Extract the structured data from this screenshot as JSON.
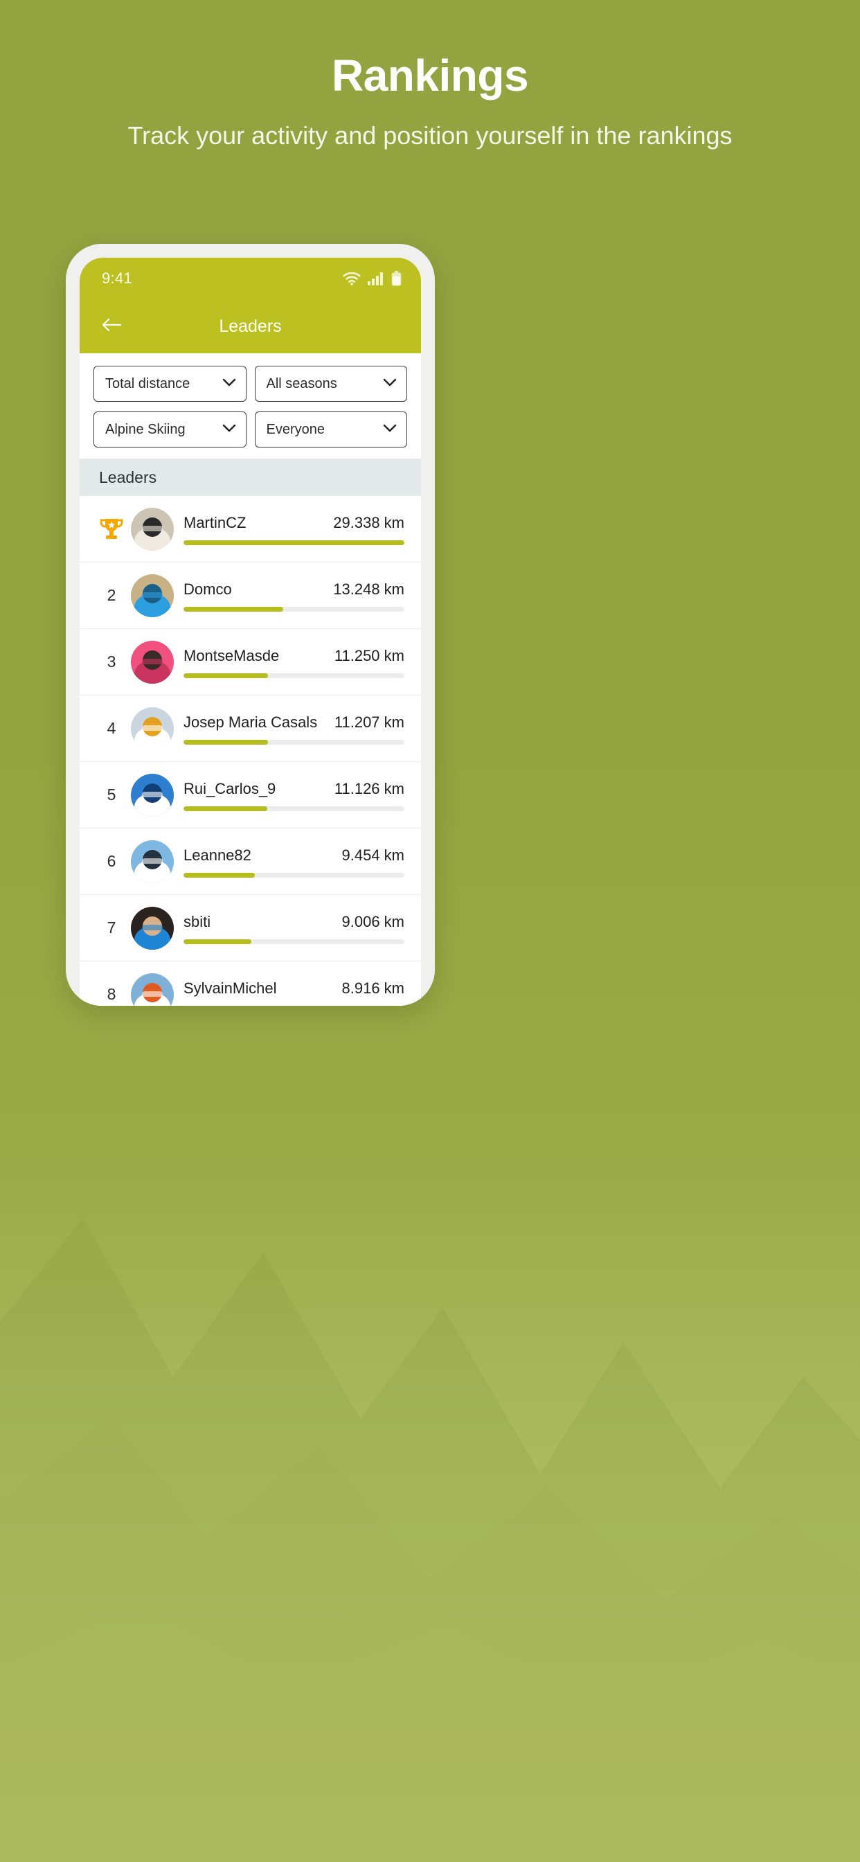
{
  "promo": {
    "title": "Rankings",
    "subtitle": "Track your activity and position yourself in the rankings"
  },
  "colors": {
    "background": "#93a33f",
    "header": "#bcc020",
    "accent": "#b5bd1f",
    "track": "#ececec",
    "section_bg": "#e4e9e9",
    "trophy": "#f5a800"
  },
  "statusbar": {
    "time": "9:41",
    "icons": [
      "wifi-icon",
      "cellular-signal-icon",
      "battery-icon"
    ]
  },
  "appbar": {
    "back_icon": "arrow-left-icon",
    "title": "Leaders"
  },
  "filters": [
    {
      "name": "metric",
      "value": "Total distance",
      "icon": "chevron-down-icon"
    },
    {
      "name": "season",
      "value": "All seasons",
      "icon": "chevron-down-icon"
    },
    {
      "name": "sport",
      "value": "Alpine Skiing",
      "icon": "chevron-down-icon"
    },
    {
      "name": "audience",
      "value": "Everyone",
      "icon": "chevron-down-icon"
    }
  ],
  "section": {
    "title": "Leaders"
  },
  "chart_data": {
    "type": "bar",
    "title": "Leaders",
    "xlabel": "",
    "ylabel": "Total distance (km)",
    "categories": [
      "MartinCZ",
      "Domco",
      "MontseMasde",
      "Josep Maria Casals",
      "Rui_Carlos_9",
      "Leanne82",
      "sbiti",
      "SylvainMichel"
    ],
    "values": [
      29.338,
      13.248,
      11.25,
      11.207,
      11.126,
      9.454,
      9.006,
      8.916
    ],
    "unit": "km",
    "ylim": [
      0,
      29.338
    ],
    "grid": false,
    "legend": "none"
  },
  "leaders": [
    {
      "rank": "1",
      "rank_badge": "trophy-icon",
      "name": "MartinCZ",
      "distance": "29.338 km",
      "value": 29.338,
      "percent": 100,
      "avatar": "avatar-helmet"
    },
    {
      "rank": "2",
      "rank_badge": "",
      "name": "Domco",
      "distance": "13.248 km",
      "value": 13.248,
      "percent": 45.2,
      "avatar": "avatar-gondola"
    },
    {
      "rank": "3",
      "rank_badge": "",
      "name": "MontseMasde",
      "distance": "11.250 km",
      "value": 11.25,
      "percent": 38.3,
      "avatar": "avatar-pink-hood"
    },
    {
      "rank": "4",
      "rank_badge": "",
      "name": "Josep Maria Casals",
      "distance": "11.207 km",
      "value": 11.207,
      "percent": 38.2,
      "avatar": "avatar-goggles"
    },
    {
      "rank": "5",
      "rank_badge": "",
      "name": "Rui_Carlos_9",
      "distance": "11.126 km",
      "value": 11.126,
      "percent": 37.9,
      "avatar": "avatar-skier"
    },
    {
      "rank": "6",
      "rank_badge": "",
      "name": "Leanne82",
      "distance": "9.454 km",
      "value": 9.454,
      "percent": 32.2,
      "avatar": "avatar-group"
    },
    {
      "rank": "7",
      "rank_badge": "",
      "name": "sbiti",
      "distance": "9.006 km",
      "value": 9.006,
      "percent": 30.7,
      "avatar": "avatar-blue-jacket"
    },
    {
      "rank": "8",
      "rank_badge": "",
      "name": "SylvainMichel",
      "distance": "8.916 km",
      "value": 8.916,
      "percent": 30.4,
      "avatar": "avatar-goggles2"
    }
  ]
}
